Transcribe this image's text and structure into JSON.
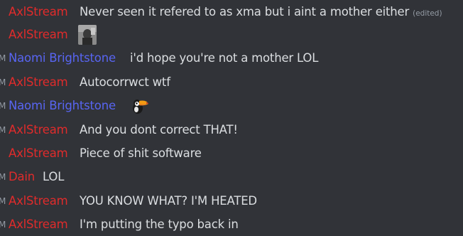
{
  "colors": {
    "background": "#313338",
    "text": "#dbdee1",
    "muted": "#949ba4",
    "axl": "#e02b2b",
    "naomi": "#5865f2",
    "dain": "#e02b2b"
  },
  "messages": [
    {
      "time_stub": "",
      "author": "AxlStream",
      "text": "Never seen it refered to as xma but i aint a mother either",
      "edited": "(edited)"
    },
    {
      "time_stub": "",
      "author": "AxlStream",
      "attachment": "image-thumbnail"
    },
    {
      "time_stub": "M",
      "author": "Naomi Brightstone",
      "text": "i'd hope you're not a mother LOL"
    },
    {
      "time_stub": "M",
      "author": "AxlStream",
      "text": "Autocorrwct wtf"
    },
    {
      "time_stub": "M",
      "author": "Naomi Brightstone",
      "emoji": "toucan-emoji"
    },
    {
      "time_stub": "M",
      "author": "AxlStream",
      "text": "And you dont correct THAT!"
    },
    {
      "time_stub": "",
      "author": "AxlStream",
      "text": "Piece of shit software"
    },
    {
      "time_stub": "M",
      "author": "Dain",
      "text": "LOL"
    },
    {
      "time_stub": "M",
      "author": "AxlStream",
      "text": "YOU KNOW WHAT? I'M HEATED"
    },
    {
      "time_stub": "M",
      "author": "AxlStream",
      "text": "I'm putting the typo back in"
    }
  ]
}
